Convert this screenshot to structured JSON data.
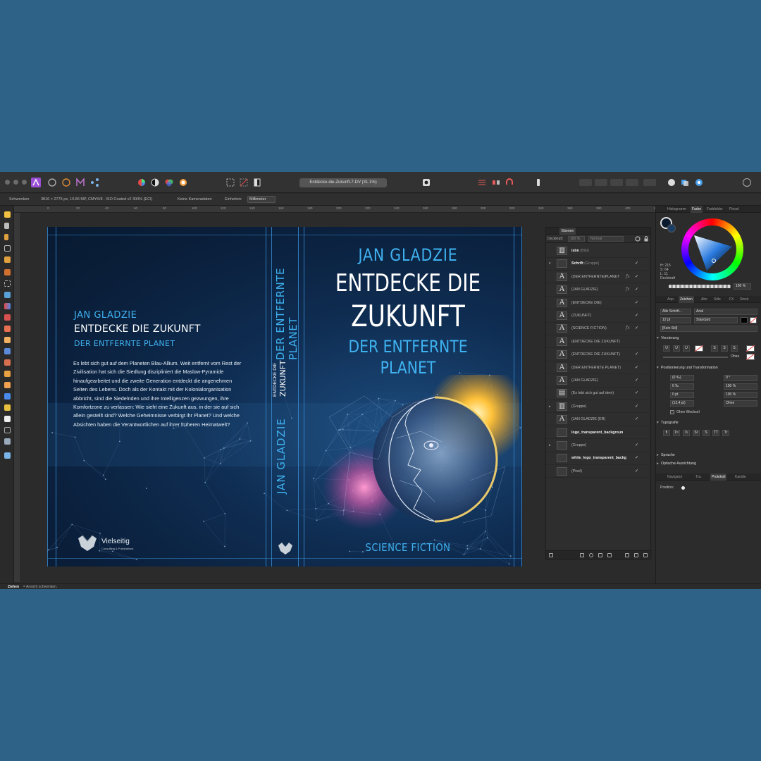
{
  "window": {
    "doc_title": "Entdecke-die-Zukunft-7-DV (31.1%)"
  },
  "context_toolbar": {
    "tool_label": "Schwenken",
    "doc_info": "3816 × 2776 px, 10.86 MP, CMYK/8 - ISO Coated v2 300% (ECI)",
    "camera": "Keine Kameradaten",
    "units_label": "Einheiten:",
    "units_value": "Millimeter"
  },
  "ruler": {
    "ticks": [
      "0",
      "20",
      "40",
      "60",
      "80",
      "100",
      "120",
      "140",
      "160",
      "180",
      "200",
      "220",
      "240",
      "260",
      "280",
      "300",
      "320",
      "340",
      "360",
      "380",
      "400",
      "420"
    ]
  },
  "cover": {
    "back": {
      "author": "JAN GLADZIE",
      "title": "ENTDECKE DIE ZUKUNFT",
      "subtitle": "DER ENTFERNTE PLANET",
      "blurb": "Es lebt sich gut auf dem Planeten Blau-Allium. Weit entfernt vom Rest der Zivilisation hat sich die Siedlung diszipliniert die Maslow-Pyramide hinaufgearbeitet und die zweite Generation entdeckt die angenehmen Seiten des Lebens. Doch als der Kontakt mit der Kolonialorganisation abbricht, sind die Siedelnden und ihre Intelligenzen gezwungen, ihre Komfortzone zu verlassen: Wie sieht eine Zukunft aus, in der sie auf sich allein gestellt sind? Welche Geheimnisse verbirgt ihr Planet? Und welche Absichten haben die Verantwortlichen auf ihrer früheren Heimatwelt?",
      "publisher_name": "Vielseitig",
      "publisher_tag": "Consulting & Publications"
    },
    "spine": {
      "author": "JAN GLADZIE",
      "title_small": "ENTDECKE DIE",
      "title_big": "ZUKUNFT",
      "subtitle": "DER ENTFERNTE PLANET"
    },
    "front": {
      "author": "JAN GLADZIE",
      "title_line1": "ENTDECKE DIE",
      "title_line2": "ZUKUNFT",
      "subtitle_line1": "DER ENTFERNTE",
      "subtitle_line2": "PLANET",
      "genre": "SCIENCE FICTION"
    }
  },
  "layers_panel": {
    "tab": "Ebenen",
    "opacity_label": "Deckkraft:",
    "opacity_value": "100 %",
    "blend_mode": "Normal",
    "layers": [
      {
        "name": "isbn",
        "suffix": "(Bild)",
        "thumb": "▥",
        "bold": true,
        "fx": "",
        "check": "",
        "expand": ""
      },
      {
        "name": "Schrift",
        "suffix": "(Gruppe)",
        "thumb": "",
        "bold": true,
        "fx": "",
        "check": "✓",
        "expand": "▾"
      },
      {
        "name": "(DER ENTFERNTE|PLANET",
        "suffix": "",
        "thumb": "A",
        "bold": false,
        "fx": "fx",
        "check": "✓",
        "expand": ""
      },
      {
        "name": "(JAN GLADZIE)",
        "suffix": "",
        "thumb": "A",
        "bold": false,
        "fx": "fx",
        "check": "✓",
        "expand": ""
      },
      {
        "name": "(ENTDECKE DIE)",
        "suffix": "",
        "thumb": "A",
        "bold": false,
        "fx": "",
        "check": "✓",
        "expand": ""
      },
      {
        "name": "(ZUKUNFT)",
        "suffix": "",
        "thumb": "A",
        "bold": false,
        "fx": "",
        "check": "✓",
        "expand": ""
      },
      {
        "name": "(SCIENCE FICTION)",
        "suffix": "",
        "thumb": "A",
        "bold": false,
        "fx": "fx",
        "check": "✓",
        "expand": ""
      },
      {
        "name": "(ENTDECKE DIE ZUKUNFT)",
        "suffix": "",
        "thumb": "A",
        "bold": false,
        "fx": "",
        "check": "",
        "expand": ""
      },
      {
        "name": "(ENTDECKE DIE ZUKUNFT)",
        "suffix": "",
        "thumb": "A",
        "bold": false,
        "fx": "",
        "check": "✓",
        "expand": ""
      },
      {
        "name": "(DER ENTFERNTE PLANET)",
        "suffix": "",
        "thumb": "A",
        "bold": false,
        "fx": "",
        "check": "✓",
        "expand": ""
      },
      {
        "name": "(JAN GLADZIE)",
        "suffix": "",
        "thumb": "A",
        "bold": false,
        "fx": "",
        "check": "✓",
        "expand": ""
      },
      {
        "name": "(Es lebt sich gut auf dem)",
        "suffix": "",
        "thumb": "▤",
        "bold": false,
        "fx": "",
        "check": "✓",
        "expand": ""
      },
      {
        "name": "(Gruppe)",
        "suffix": "",
        "thumb": "▥",
        "bold": false,
        "fx": "",
        "check": "✓",
        "expand": "▸"
      },
      {
        "name": "(JAN GLADZIE       (ER)",
        "suffix": "",
        "thumb": "A",
        "bold": false,
        "fx": "",
        "check": "✓",
        "expand": ""
      },
      {
        "name": "logo_transparent_backgroun",
        "suffix": "",
        "thumb": "",
        "bold": true,
        "fx": "",
        "check": "",
        "expand": ""
      },
      {
        "name": "(Gruppe)",
        "suffix": "",
        "thumb": "",
        "bold": false,
        "fx": "",
        "check": "✓",
        "expand": "▸"
      },
      {
        "name": "white_logo_transparent_backg",
        "suffix": "",
        "thumb": "",
        "bold": true,
        "fx": "",
        "check": "✓",
        "expand": ""
      },
      {
        "name": "(Pixel)",
        "suffix": "",
        "thumb": "",
        "bold": false,
        "fx": "",
        "check": "✓",
        "expand": ""
      }
    ]
  },
  "right_panel": {
    "top_tabs": [
      "Histogramm",
      "Farbe",
      "Farbfelder",
      "Pinsel"
    ],
    "color": {
      "h": "H: 215",
      "s": "S: 64",
      "l": "L: 11",
      "opacity_label": "Deckkraft",
      "opacity_value": "100 %"
    },
    "mid_tabs": [
      "Anp.",
      "Zeichen",
      "Abs",
      "Stile",
      "FX",
      "Stock"
    ],
    "character": {
      "font_scope": "Alle Schrift...",
      "font_family": "Arial",
      "font_size": "12 pt",
      "font_style": "Standard",
      "paragraph_style": "[Kein Stil]",
      "decoration_label": "Verzierung",
      "deco_buttons": [
        "U",
        "U",
        "U",
        "S",
        "S",
        "S"
      ],
      "deco_value": "Ohne",
      "position_label": "Positionierung und Transformation",
      "tracking": "(0 ‰)",
      "kerning": "0 ‰",
      "baseline": "0 pt",
      "leading": "(13,4 pt)",
      "angle": "0 °",
      "scale_h": "100 %",
      "scale_v": "100 %",
      "wrap": "Ohne",
      "no_break": "Ohne Wechsel",
      "typo_label": "Typografie",
      "typo_buttons": [
        "fi",
        "1ˢᵗ",
        "½",
        "Sᵖ",
        "S",
        "TT",
        "Tr"
      ],
      "language_label": "Sprache",
      "optical_label": "Optische Ausrichtung"
    },
    "bottom_tabs": [
      "Navigator",
      "Tra.",
      "Protokoll",
      "Kanäle"
    ],
    "history_label": "Position:"
  },
  "statusbar": {
    "bold": "Ziehen",
    "text": "= Ansicht schwenken."
  },
  "colors": {
    "accent": "#3fb2f0",
    "cover_dark": "#0a1f3b",
    "guide": "#3a8fd6"
  }
}
